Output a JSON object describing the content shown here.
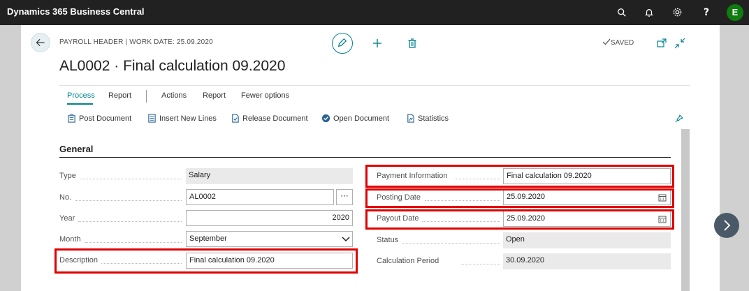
{
  "app": {
    "title": "Dynamics 365 Business Central",
    "user_initial": "E"
  },
  "header": {
    "breadcrumb": "PAYROLL HEADER | WORK DATE: 25.09.2020",
    "title": "AL0002 · Final calculation 09.2020",
    "status": "SAVED"
  },
  "menu": {
    "tabs": [
      "Process",
      "Report"
    ],
    "items": [
      "Actions",
      "Report",
      "Fewer options"
    ]
  },
  "actions": [
    "Post Document",
    "Insert New Lines",
    "Release Document",
    "Open Document",
    "Statistics"
  ],
  "section": {
    "title": "General"
  },
  "left_fields": [
    {
      "label": "Type",
      "value": "Salary"
    },
    {
      "label": "No.",
      "value": "AL0002"
    },
    {
      "label": "Year",
      "value": "2020"
    },
    {
      "label": "Month",
      "value": "September"
    },
    {
      "label": "Description",
      "value": "Final calculation 09.2020"
    }
  ],
  "right_fields": [
    {
      "label": "Payment Information",
      "value": "Final calculation 09.2020"
    },
    {
      "label": "Posting Date",
      "value": "25.09.2020"
    },
    {
      "label": "Payout Date",
      "value": "25.09.2020"
    },
    {
      "label": "Status",
      "value": "Open"
    },
    {
      "label": "Calculation Period",
      "value": "30.09.2020"
    }
  ],
  "colors": {
    "accent": "#00838f",
    "highlight": "#e00000",
    "topbar": "#212121"
  }
}
